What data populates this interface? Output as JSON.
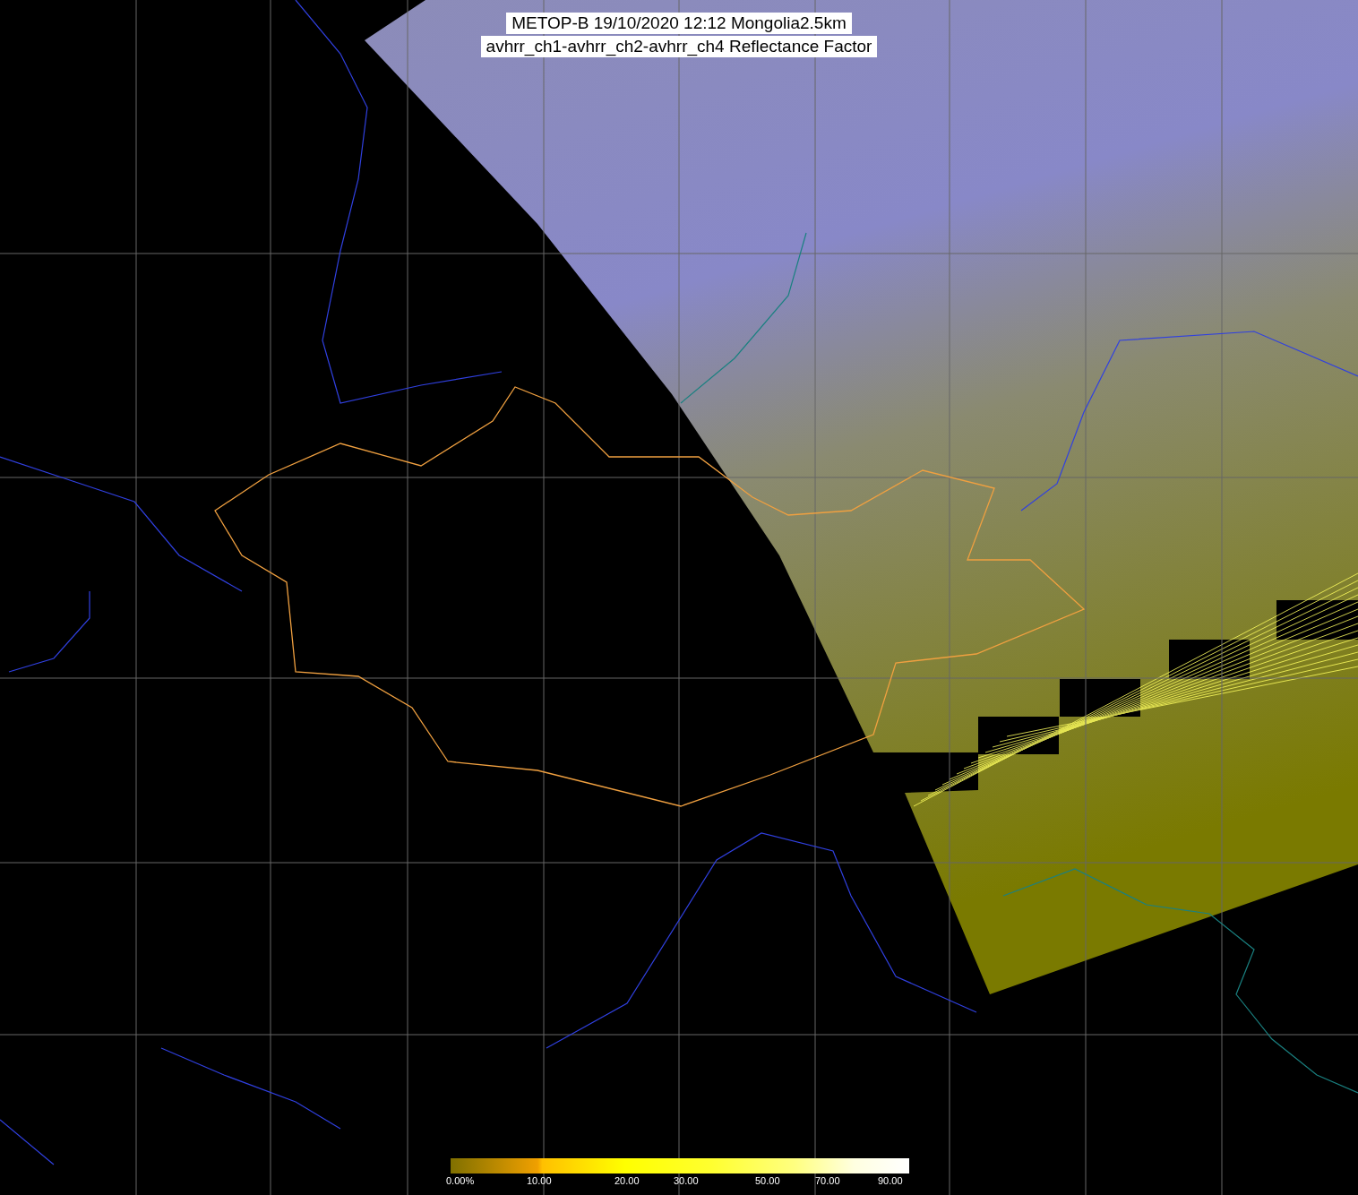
{
  "title": {
    "line_1": "METOP-B 19/10/2020 12:12 Mongolia2.5km",
    "line_2": "avhrr_ch1-avhrr_ch2-avhrr_ch4 Reflectance Factor"
  },
  "colorbar": {
    "labels": [
      "0.00%",
      "10.00",
      "20.00",
      "30.00",
      "50.00",
      "70.00",
      "90.00"
    ]
  }
}
